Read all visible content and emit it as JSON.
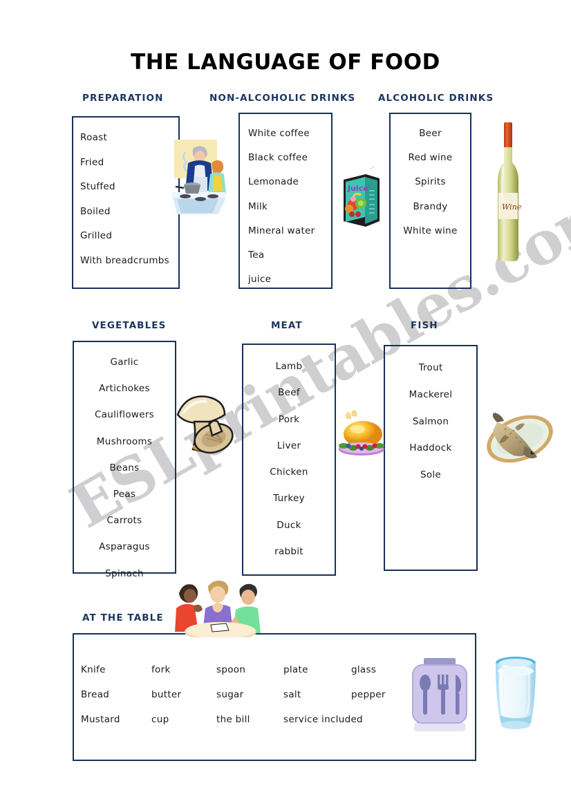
{
  "page": {
    "title": "THE LANGUAGE OF FOOD",
    "watermark": "ESLprintables.com",
    "accent_navy": "#16305c",
    "header_navy": "#1b355f",
    "title_color": "#000000"
  },
  "sections": {
    "preparation": {
      "header": "PREPARATION",
      "items": [
        "Roast",
        "Fried",
        "Stuffed",
        "Boiled",
        "Grilled",
        "With breadcrumbs"
      ]
    },
    "non_alcoholic": {
      "header": "NON-ALCOHOLIC DRINKS",
      "items": [
        "White coffee",
        "Black coffee",
        "Lemonade",
        "Milk",
        "Mineral water",
        "Tea",
        "juice"
      ]
    },
    "alcoholic": {
      "header": "ALCOHOLIC DRINKS",
      "items": [
        "Beer",
        "Red wine",
        "Spirits",
        "Brandy",
        "White wine"
      ]
    },
    "vegetables": {
      "header": "VEGETABLES",
      "items": [
        "Garlic",
        "Artichokes",
        "Cauliflowers",
        "Mushrooms",
        "Beans",
        "Peas",
        "Carrots",
        "Asparagus",
        "Spinach"
      ]
    },
    "meat": {
      "header": "MEAT",
      "items": [
        "Lamb",
        "Beef",
        "Pork",
        "Liver",
        "Chicken",
        "Turkey",
        "Duck",
        "rabbit"
      ]
    },
    "fish": {
      "header": "FISH",
      "items": [
        "Trout",
        "Mackerel",
        "Salmon",
        "Haddock",
        "Sole"
      ]
    },
    "at_the_table": {
      "header": "AT THE TABLE",
      "rows": [
        [
          "Knife",
          "fork",
          "spoon",
          "plate",
          "glass"
        ],
        [
          "Bread",
          "butter",
          "sugar",
          "salt",
          "pepper"
        ],
        [
          "Mustard",
          "cup",
          "the bill",
          "service included"
        ]
      ]
    }
  },
  "clipart": {
    "cooking": "cooking-scene-clipart",
    "juice": "juice-carton-clipart",
    "juice_label": "Juice",
    "wine": "wine-bottle-clipart",
    "wine_label": "Wine",
    "mushrooms": "mushrooms-clipart",
    "turkey": "roast-turkey-clipart",
    "fish": "fish-on-platter-clipart",
    "diners": "people-at-table-clipart",
    "cutlery": "cutlery-icon",
    "glass": "water-glass-clipart"
  }
}
